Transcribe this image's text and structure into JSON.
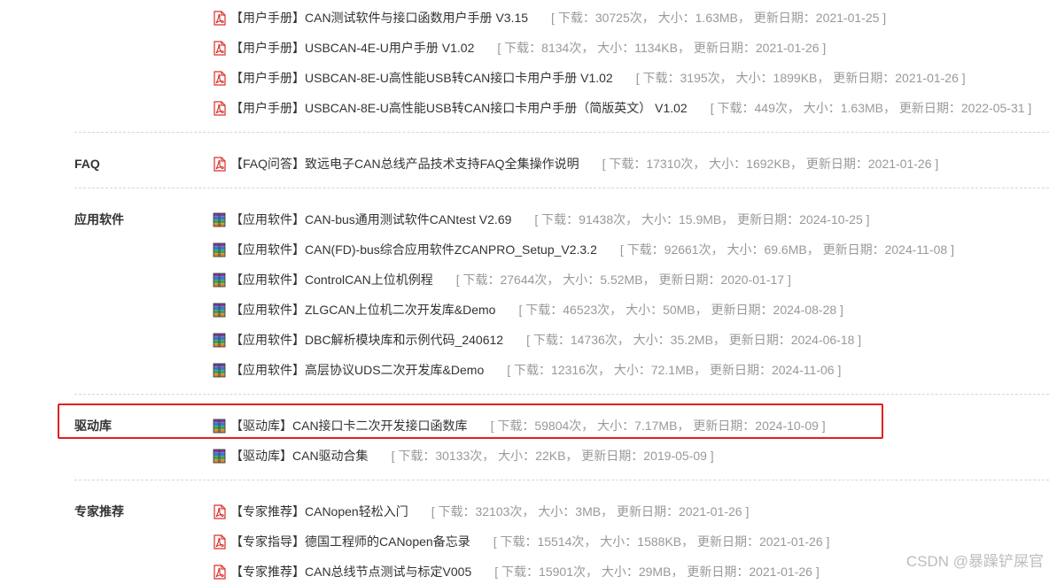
{
  "sections": [
    {
      "label": "",
      "items": [
        {
          "icon": "pdf-icon",
          "title": "【用户手册】CAN测试软件与接口函数用户手册 V3.15",
          "meta": "[ 下载：30725次， 大小：1.63MB， 更新日期：2021-01-25 ]"
        },
        {
          "icon": "pdf-icon",
          "title": "【用户手册】USBCAN-4E-U用户手册 V1.02",
          "meta": "[ 下载：8134次， 大小：1134KB， 更新日期：2021-01-26 ]"
        },
        {
          "icon": "pdf-icon",
          "title": "【用户手册】USBCAN-8E-U高性能USB转CAN接口卡用户手册 V1.02",
          "meta": "[ 下载：3195次， 大小：1899KB， 更新日期：2021-01-26 ]"
        },
        {
          "icon": "pdf-icon",
          "title": "【用户手册】USBCAN-8E-U高性能USB转CAN接口卡用户手册（简版英文） V1.02",
          "meta": "[ 下载：449次， 大小：1.63MB， 更新日期：2022-05-31 ]"
        }
      ]
    },
    {
      "label": "FAQ",
      "items": [
        {
          "icon": "pdf-icon",
          "title": "【FAQ问答】致远电子CAN总线产品技术支持FAQ全集操作说明",
          "meta": "[ 下载：17310次， 大小：1692KB， 更新日期：2021-01-26 ]"
        }
      ]
    },
    {
      "label": "应用软件",
      "items": [
        {
          "icon": "archive-icon",
          "title": "【应用软件】CAN-bus通用测试软件CANtest V2.69",
          "meta": "[ 下载：91438次， 大小：15.9MB， 更新日期：2024-10-25 ]"
        },
        {
          "icon": "archive-icon",
          "title": "【应用软件】CAN(FD)-bus综合应用软件ZCANPRO_Setup_V2.3.2",
          "meta": "[ 下载：92661次， 大小：69.6MB， 更新日期：2024-11-08 ]"
        },
        {
          "icon": "archive-icon",
          "title": "【应用软件】ControlCAN上位机例程",
          "meta": "[ 下载：27644次， 大小：5.52MB， 更新日期：2020-01-17 ]"
        },
        {
          "icon": "archive-icon",
          "title": "【应用软件】ZLGCAN上位机二次开发库&Demo",
          "meta": "[ 下载：46523次， 大小：50MB， 更新日期：2024-08-28 ]"
        },
        {
          "icon": "archive-icon",
          "title": "【应用软件】DBC解析模块库和示例代码_240612",
          "meta": "[ 下载：14736次， 大小：35.2MB， 更新日期：2024-06-18 ]"
        },
        {
          "icon": "archive-icon",
          "title": "【应用软件】高层协议UDS二次开发库&Demo",
          "meta": "[ 下载：12316次， 大小：72.1MB， 更新日期：2024-11-06 ]"
        }
      ]
    },
    {
      "label": "驱动库",
      "items": [
        {
          "icon": "archive-icon",
          "title": "【驱动库】CAN接口卡二次开发接口函数库",
          "meta": "[ 下载：59804次， 大小：7.17MB， 更新日期：2024-10-09 ]"
        },
        {
          "icon": "archive-icon",
          "title": "【驱动库】CAN驱动合集",
          "meta": "[ 下载：30133次， 大小：22KB， 更新日期：2019-05-09 ]"
        }
      ]
    },
    {
      "label": "专家推荐",
      "items": [
        {
          "icon": "pdf-icon",
          "title": "【专家推荐】CANopen轻松入门",
          "meta": "[ 下载：32103次， 大小：3MB， 更新日期：2021-01-26 ]"
        },
        {
          "icon": "pdf-icon",
          "title": "【专家指导】德国工程师的CANopen备忘录",
          "meta": "[ 下载：15514次， 大小：1588KB， 更新日期：2021-01-26 ]"
        },
        {
          "icon": "pdf-icon",
          "title": "【专家推荐】CAN总线节点测试与标定V005",
          "meta": "[ 下载：15901次， 大小：29MB， 更新日期：2021-01-26 ]"
        }
      ]
    }
  ],
  "watermark": "CSDN @暴躁铲屎官",
  "colors": {
    "highlight": "#e02020",
    "pdf": "#d9302c",
    "meta": "#999999"
  }
}
